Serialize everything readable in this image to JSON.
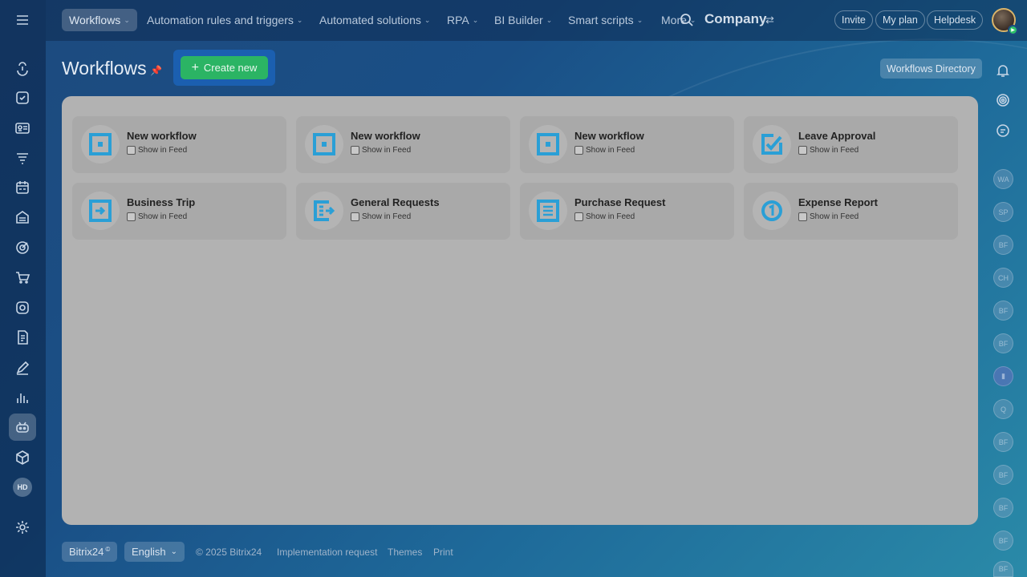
{
  "topnav": {
    "menu_icon": "hamburger-icon",
    "items": [
      {
        "label": "Workflows"
      },
      {
        "label": "Automation rules and triggers"
      },
      {
        "label": "Automated solutions"
      },
      {
        "label": "RPA"
      },
      {
        "label": "BI Builder"
      },
      {
        "label": "Smart scripts"
      },
      {
        "label": "More"
      }
    ],
    "company": "Company",
    "invite": "Invite",
    "my_plan": "My plan",
    "helpdesk": "Helpdesk"
  },
  "page": {
    "title": "Workflows",
    "create_label": "Create new",
    "directory_label": "Workflows Directory"
  },
  "cards": [
    {
      "title": "New workflow",
      "checkbox_label": "Show in Feed",
      "icon": "square-icon",
      "checked": false
    },
    {
      "title": "New workflow",
      "checkbox_label": "Show in Feed",
      "icon": "square-icon",
      "checked": false
    },
    {
      "title": "New workflow",
      "checkbox_label": "Show in Feed",
      "icon": "square-icon",
      "checked": false
    },
    {
      "title": "Leave Approval",
      "checkbox_label": "Show in Feed",
      "icon": "approval-icon",
      "checked": false
    },
    {
      "title": "Business Trip",
      "checkbox_label": "Show in Feed",
      "icon": "arrow-box-icon",
      "checked": false
    },
    {
      "title": "General Requests",
      "checkbox_label": "Show in Feed",
      "icon": "request-icon",
      "checked": false
    },
    {
      "title": "Purchase Request",
      "checkbox_label": "Show in Feed",
      "icon": "document-icon",
      "checked": false
    },
    {
      "title": "Expense Report",
      "checkbox_label": "Show in Feed",
      "icon": "number-one-icon",
      "checked": false
    }
  ],
  "sidebar": {
    "hd_label": "HD"
  },
  "right_badges": [
    "WA",
    "SP",
    "BF",
    "CH",
    "BF",
    "BF",
    "Q",
    "BF",
    "BF",
    "BF",
    "BF",
    "BF"
  ],
  "footer": {
    "brand": "Bitrix24",
    "brand_mark": "©",
    "language": "English",
    "copyright": "© 2025 Bitrix24",
    "implementation": "Implementation request",
    "themes": "Themes",
    "print": "Print"
  },
  "colors": {
    "accent_green": "#2bb464",
    "icon_blue": "#2a9fd6",
    "panel_gray": "#b2b2b2"
  }
}
